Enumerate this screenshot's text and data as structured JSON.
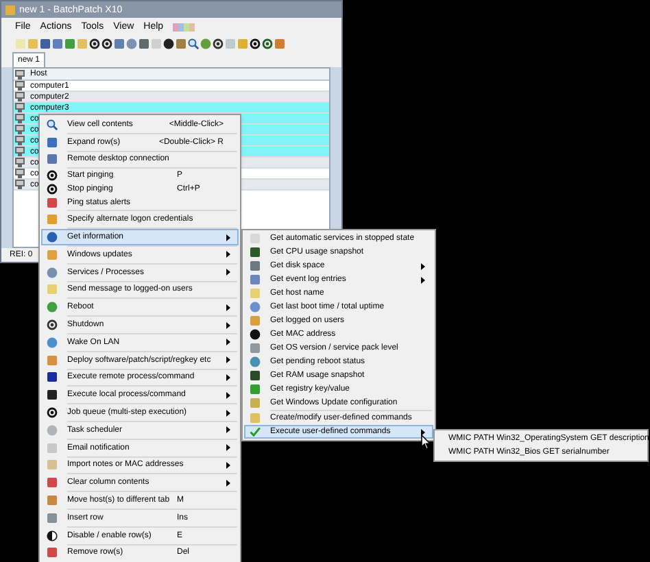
{
  "window": {
    "title": "new 1 - BatchPatch X10"
  },
  "menu_bar": [
    "File",
    "Actions",
    "Tools",
    "View",
    "Help"
  ],
  "tabs": [
    {
      "label": "new 1",
      "selected": true
    }
  ],
  "grid": {
    "columns": [
      "Host"
    ],
    "rows": [
      {
        "host": "computer1",
        "selected": false
      },
      {
        "host": "computer2",
        "selected": false
      },
      {
        "host": "computer3",
        "selected": true
      },
      {
        "host": "co",
        "selected": true
      },
      {
        "host": "co",
        "selected": true
      },
      {
        "host": "co",
        "selected": true
      },
      {
        "host": "co",
        "selected": true
      },
      {
        "host": "co",
        "selected": false
      },
      {
        "host": "co",
        "selected": false
      },
      {
        "host": "co",
        "selected": false
      }
    ]
  },
  "status_bar": "REI: 0",
  "context_menu": {
    "groups": [
      [
        {
          "label": "View cell contents",
          "shortcut": "<Middle-Click>",
          "submenu": false,
          "highlighted": false
        }
      ],
      [
        {
          "label": "Expand row(s)",
          "shortcut": "<Double-Click> R",
          "submenu": false,
          "highlighted": false
        }
      ],
      [
        {
          "label": "Remote desktop connection",
          "submenu": false,
          "highlighted": false
        }
      ],
      [
        {
          "label": "Start pinging",
          "shortcut": "P",
          "submenu": false,
          "highlighted": false
        },
        {
          "label": "Stop pinging",
          "shortcut": "Ctrl+P",
          "submenu": false,
          "highlighted": false
        },
        {
          "label": "Ping status alerts",
          "submenu": false,
          "highlighted": false
        }
      ],
      [
        {
          "label": "Specify alternate logon credentials",
          "submenu": false,
          "highlighted": false
        }
      ],
      [
        {
          "label": "Get information",
          "submenu": true,
          "highlighted": true
        }
      ],
      [
        {
          "label": "Windows updates",
          "submenu": true,
          "highlighted": false
        }
      ],
      [
        {
          "label": "Services / Processes",
          "submenu": true,
          "highlighted": false
        }
      ],
      [
        {
          "label": "Send message to logged-on users",
          "submenu": false,
          "highlighted": false
        }
      ],
      [
        {
          "label": "Reboot",
          "submenu": true,
          "highlighted": false
        }
      ],
      [
        {
          "label": "Shutdown",
          "submenu": true,
          "highlighted": false
        }
      ],
      [
        {
          "label": "Wake On LAN",
          "submenu": true,
          "highlighted": false
        }
      ],
      [
        {
          "label": "Deploy software/patch/script/regkey etc",
          "submenu": true,
          "highlighted": false
        }
      ],
      [
        {
          "label": "Execute remote process/command",
          "submenu": true,
          "highlighted": false
        }
      ],
      [
        {
          "label": "Execute local process/command",
          "submenu": true,
          "highlighted": false
        }
      ],
      [
        {
          "label": "Job queue (multi-step execution)",
          "submenu": true,
          "highlighted": false
        }
      ],
      [
        {
          "label": "Task scheduler",
          "submenu": true,
          "highlighted": false
        }
      ],
      [
        {
          "label": "Email notification",
          "submenu": true,
          "highlighted": false
        }
      ],
      [
        {
          "label": "Import notes or MAC addresses",
          "submenu": true,
          "highlighted": false
        }
      ],
      [
        {
          "label": "Clear column contents",
          "submenu": true,
          "highlighted": false
        }
      ],
      [
        {
          "label": "Move host(s) to different tab",
          "shortcut": "M",
          "submenu": false,
          "highlighted": false
        }
      ],
      [
        {
          "label": "Insert row",
          "shortcut": "Ins",
          "submenu": false,
          "highlighted": false
        }
      ],
      [
        {
          "label": "Disable / enable row(s)",
          "shortcut": "E",
          "submenu": false,
          "highlighted": false
        }
      ],
      [
        {
          "label": "Remove row(s)",
          "shortcut": "Del",
          "submenu": false,
          "highlighted": false
        }
      ]
    ]
  },
  "info_submenu": {
    "groups": [
      [
        {
          "label": "Get automatic services in stopped state",
          "submenu": false,
          "highlighted": false
        },
        {
          "label": "Get CPU usage snapshot",
          "submenu": false,
          "highlighted": false
        },
        {
          "label": "Get disk space",
          "submenu": true,
          "highlighted": false
        },
        {
          "label": "Get event log entries",
          "submenu": true,
          "highlighted": false
        },
        {
          "label": "Get host name",
          "submenu": false,
          "highlighted": false
        },
        {
          "label": "Get last boot time / total uptime",
          "submenu": false,
          "highlighted": false
        },
        {
          "label": "Get logged on users",
          "submenu": false,
          "highlighted": false
        },
        {
          "label": "Get MAC address",
          "submenu": false,
          "highlighted": false
        },
        {
          "label": "Get OS version / service pack level",
          "submenu": false,
          "highlighted": false
        },
        {
          "label": "Get pending reboot status",
          "submenu": false,
          "highlighted": false
        },
        {
          "label": "Get RAM usage snapshot",
          "submenu": false,
          "highlighted": false
        },
        {
          "label": "Get registry key/value",
          "submenu": false,
          "highlighted": false
        },
        {
          "label": "Get Windows Update configuration",
          "submenu": false,
          "highlighted": false
        }
      ],
      [
        {
          "label": "Create/modify user-defined commands",
          "submenu": false,
          "highlighted": false
        },
        {
          "label": "Execute user-defined commands",
          "submenu": true,
          "highlighted": true
        }
      ]
    ]
  },
  "commands_submenu": {
    "groups": [
      [
        {
          "label": "WMIC PATH Win32_OperatingSystem GET description",
          "highlighted": false
        },
        {
          "label": "WMIC PATH Win32_Bios GET serialnumber",
          "highlighted": false
        }
      ]
    ]
  }
}
